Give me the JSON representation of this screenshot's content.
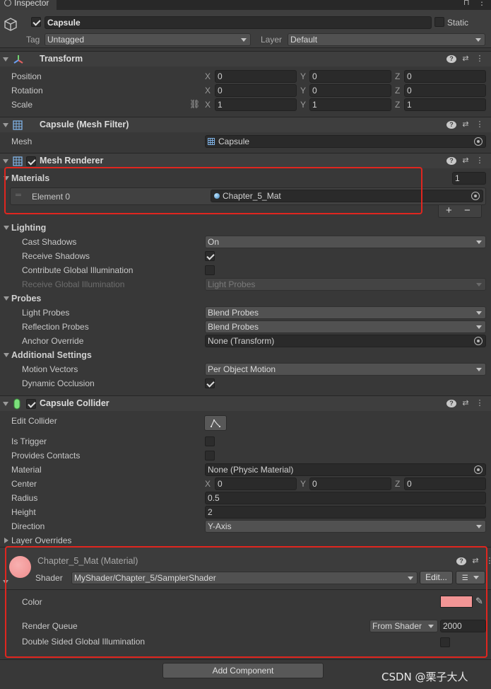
{
  "tab": {
    "title": "Inspector"
  },
  "gameobject": {
    "name": "Capsule",
    "static_label": "Static",
    "tag_label": "Tag",
    "tag_value": "Untagged",
    "layer_label": "Layer",
    "layer_value": "Default"
  },
  "transform": {
    "title": "Transform",
    "rows": [
      {
        "label": "Position",
        "x": "0",
        "y": "0",
        "z": "0"
      },
      {
        "label": "Rotation",
        "x": "0",
        "y": "0",
        "z": "0"
      },
      {
        "label": "Scale",
        "x": "1",
        "y": "1",
        "z": "1"
      }
    ],
    "axes": {
      "x": "X",
      "y": "Y",
      "z": "Z"
    }
  },
  "mesh_filter": {
    "title": "Capsule (Mesh Filter)",
    "mesh_label": "Mesh",
    "mesh_value": "Capsule"
  },
  "mesh_renderer": {
    "title": "Mesh Renderer",
    "materials_label": "Materials",
    "materials_count": "1",
    "element_label": "Element 0",
    "element_value": "Chapter_5_Mat",
    "plus": "+",
    "minus": "−",
    "lighting": {
      "title": "Lighting",
      "cast_shadows_label": "Cast Shadows",
      "cast_shadows_value": "On",
      "receive_shadows_label": "Receive Shadows",
      "contribute_gi_label": "Contribute Global Illumination",
      "receive_gi_label": "Receive Global Illumination",
      "receive_gi_value": "Light Probes"
    },
    "probes": {
      "title": "Probes",
      "light_probes_label": "Light Probes",
      "light_probes_value": "Blend Probes",
      "reflection_probes_label": "Reflection Probes",
      "reflection_probes_value": "Blend Probes",
      "anchor_label": "Anchor Override",
      "anchor_value": "None (Transform)"
    },
    "additional": {
      "title": "Additional Settings",
      "motion_vectors_label": "Motion Vectors",
      "motion_vectors_value": "Per Object Motion",
      "dynamic_occlusion_label": "Dynamic Occlusion"
    }
  },
  "capsule_collider": {
    "title": "Capsule Collider",
    "edit_collider_label": "Edit Collider",
    "is_trigger_label": "Is Trigger",
    "provides_contacts_label": "Provides Contacts",
    "material_label": "Material",
    "material_value": "None (Physic Material)",
    "center_label": "Center",
    "center_x": "0",
    "center_y": "0",
    "center_z": "0",
    "radius_label": "Radius",
    "radius_value": "0.5",
    "height_label": "Height",
    "height_value": "2",
    "direction_label": "Direction",
    "direction_value": "Y-Axis",
    "layer_overrides_label": "Layer Overrides"
  },
  "material": {
    "title": "Chapter_5_Mat (Material)",
    "shader_label": "Shader",
    "shader_value": "MyShader/Chapter_5/SamplerShader",
    "edit_button": "Edit...",
    "color_label": "Color",
    "color_value": "#f29595",
    "render_queue_label": "Render Queue",
    "render_queue_mode": "From Shader",
    "render_queue_value": "2000",
    "double_sided_label": "Double Sided Global Illumination"
  },
  "add_component": "Add Component",
  "watermark": "CSDN @栗子大人",
  "colors": {
    "highlight": "#e0261f",
    "panel": "#383838",
    "header": "#3e3e3e"
  }
}
